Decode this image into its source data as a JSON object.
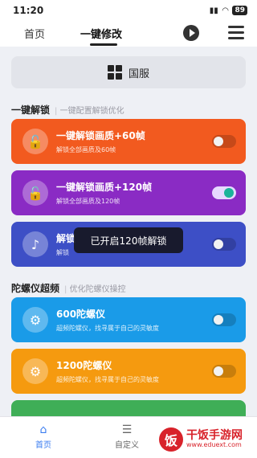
{
  "status_bar": {
    "time": "11:20",
    "battery": "89"
  },
  "top_nav": {
    "tabs": [
      "首页",
      "一键修改"
    ]
  },
  "guofu_button": {
    "label": "国服"
  },
  "sections": [
    {
      "title": "一键解锁",
      "subtitle": "一键配置解锁优化"
    },
    {
      "title": "陀螺仪超频",
      "subtitle": "优化陀螺仪操控"
    }
  ],
  "cards": [
    {
      "title": "一键解锁画质+60帧",
      "desc": "解锁全部画质及60帧",
      "icon": "unlock-icon",
      "color": "#f25a1f",
      "toggle": "off"
    },
    {
      "title": "一键解锁画质+120帧",
      "desc": "解锁全部画质及120帧",
      "icon": "unlock-icon",
      "color": "#8a2bc4",
      "toggle": "on"
    },
    {
      "title": "解锁",
      "desc": "解锁",
      "icon": "music-note-icon",
      "color": "#3d4fc6",
      "toggle": "off"
    },
    {
      "title": "600陀螺仪",
      "desc": "超频陀螺仪，找寻属于自己的灵敏度",
      "icon": "gear-icon",
      "color": "#1a9be8",
      "toggle": "off"
    },
    {
      "title": "1200陀螺仪",
      "desc": "超频陀螺仪，找寻属于自己的灵敏度",
      "icon": "gear-icon",
      "color": "#f59a0f",
      "toggle": "off"
    },
    {
      "color": "#3fae57"
    }
  ],
  "toast": {
    "text": "已开启120帧解锁"
  },
  "bottom_nav": {
    "items": [
      "首页",
      "自定义"
    ]
  },
  "watermark": {
    "logo": "饭",
    "name": "干饭手游网",
    "url": "www.eduext.com"
  }
}
